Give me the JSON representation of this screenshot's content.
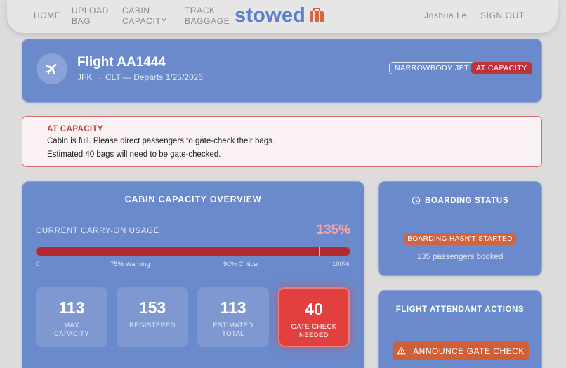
{
  "nav": {
    "links": [
      "Home",
      "Upload Bag",
      "Cabin Capacity",
      "Track Baggage"
    ],
    "brand": "stowed",
    "user": "Joshua Le",
    "signout": "Sign Out"
  },
  "flight": {
    "title": "Flight AA1444",
    "route": "JFK → CLT — Departs 1/25/2026",
    "aircraft_badge": "NARROWBODY JET",
    "capacity_badge": "AT CAPACITY"
  },
  "alert": {
    "title": "AT CAPACITY",
    "line1": "Cabin is full. Please direct passengers to gate-check their bags.",
    "line2": "Estimated 40 bags will need to be gate-checked."
  },
  "overview": {
    "title": "CABIN CAPACITY OVERVIEW",
    "usage_label": "CURRENT CARRY-ON USAGE",
    "usage_pct": "135%",
    "usage_fraction": 1.0,
    "ticks": [
      "0",
      "75% Warning",
      "90% Critical",
      "100%"
    ],
    "stats": [
      {
        "value": "113",
        "label": "Max Capacity"
      },
      {
        "value": "153",
        "label": "Registered"
      },
      {
        "value": "113",
        "label": "Estimated Total"
      },
      {
        "value": "40",
        "label": "Gate Check Needed"
      }
    ]
  },
  "boarding": {
    "title": "BOARDING STATUS",
    "badge": "Boarding hasn't started",
    "booked": "135 passengers booked"
  },
  "attendant": {
    "title": "FLIGHT ATTENDANT ACTIONS",
    "button": "Announce Gate Check"
  },
  "colors": {
    "brand": "#5b7fcf",
    "card": "#6b8acb",
    "critical": "#c0313a",
    "warning_orange": "#cf6342"
  }
}
